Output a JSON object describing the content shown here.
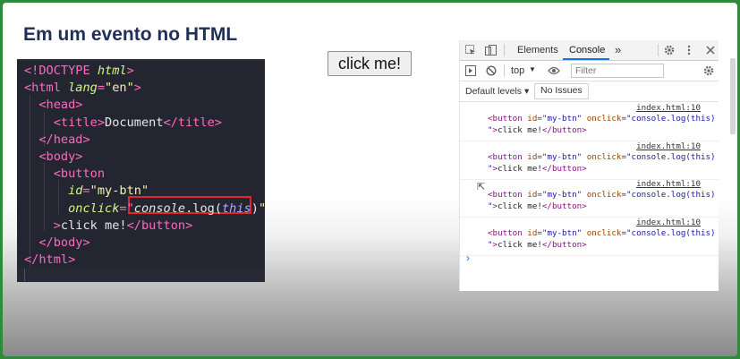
{
  "slide": {
    "title": "Em um evento no HTML"
  },
  "code": {
    "lines": [
      {
        "parts": [
          {
            "t": "<!DOCTYPE ",
            "c": "tag"
          },
          {
            "t": "html",
            "c": "attr"
          },
          {
            "t": ">",
            "c": "tag"
          }
        ]
      },
      {
        "parts": [
          {
            "t": "<html ",
            "c": "tag"
          },
          {
            "t": "lang",
            "c": "attr"
          },
          {
            "t": "=",
            "c": "tag"
          },
          {
            "t": "\"en\"",
            "c": "str"
          },
          {
            "t": ">",
            "c": "tag"
          }
        ]
      },
      {
        "parts": [
          {
            "t": "  <head>",
            "c": "tag"
          }
        ]
      },
      {
        "parts": [
          {
            "t": "    <title>",
            "c": "tag"
          },
          {
            "t": "Document",
            "c": ""
          },
          {
            "t": "</title>",
            "c": "tag"
          }
        ]
      },
      {
        "parts": [
          {
            "t": "  </head>",
            "c": "tag"
          }
        ]
      },
      {
        "parts": [
          {
            "t": "  <body>",
            "c": "tag"
          }
        ]
      },
      {
        "parts": [
          {
            "t": "    <button",
            "c": "tag"
          }
        ]
      },
      {
        "parts": [
          {
            "t": "      ",
            "c": ""
          },
          {
            "t": "id",
            "c": "attr"
          },
          {
            "t": "=",
            "c": "tag"
          },
          {
            "t": "\"my-btn\"",
            "c": "str"
          }
        ]
      },
      {
        "parts": [
          {
            "t": "      ",
            "c": ""
          },
          {
            "t": "onclick",
            "c": "attr"
          },
          {
            "t": "=\"",
            "c": "tag"
          },
          {
            "t": "console",
            "c": "ital"
          },
          {
            "t": ".log(",
            "c": ""
          },
          {
            "t": "this",
            "c": "kw"
          },
          {
            "t": ")",
            "c": ""
          },
          {
            "t": "\"",
            "c": "str"
          }
        ]
      },
      {
        "parts": [
          {
            "t": "    >",
            "c": "tag"
          },
          {
            "t": "click me!",
            "c": ""
          },
          {
            "t": "</button>",
            "c": "tag"
          }
        ]
      },
      {
        "parts": [
          {
            "t": "  </body>",
            "c": "tag"
          }
        ]
      },
      {
        "parts": [
          {
            "t": "</html>",
            "c": "tag"
          }
        ]
      }
    ]
  },
  "page": {
    "button_label": "click me!"
  },
  "devtools": {
    "tabs": [
      "Elements",
      "Console"
    ],
    "more_tabs_icon": "»",
    "context": "top",
    "filter_placeholder": "Filter",
    "levels_label": "Default levels",
    "issues_label": "No Issues",
    "entries": [
      {
        "source": "index.html:10",
        "line1": {
          "tag_open": "<button",
          "a1": "id",
          "v1": "\"my-btn\"",
          "a2": "onclick",
          "v2": "\"console.log(this)"
        },
        "line2": {
          "v_end": "\"",
          "tag_close": ">",
          "text": "click me!",
          "end_tag": "</button>"
        }
      },
      {
        "source": "index.html:10",
        "line1": {
          "tag_open": "<button",
          "a1": "id",
          "v1": "\"my-btn\"",
          "a2": "onclick",
          "v2": "\"console.log(this)"
        },
        "line2": {
          "v_end": "\"",
          "tag_close": ">",
          "text": "click me!",
          "end_tag": "</button>"
        }
      },
      {
        "source": "index.html:10",
        "line1": {
          "tag_open": "<button",
          "a1": "id",
          "v1": "\"my-btn\"",
          "a2": "onclick",
          "v2": "\"console.log(this)"
        },
        "line2": {
          "v_end": "\"",
          "tag_close": ">",
          "text": "click me!",
          "end_tag": "</button>"
        }
      },
      {
        "source": "index.html:10",
        "line1": {
          "tag_open": "<button",
          "a1": "id",
          "v1": "\"my-btn\"",
          "a2": "onclick",
          "v2": "\"console.log(this)"
        },
        "line2": {
          "v_end": "\"",
          "tag_close": ">",
          "text": "click me!",
          "end_tag": "</button>"
        }
      }
    ],
    "prompt_icon": "›"
  },
  "icons": {
    "inspect": "inspect-element-icon",
    "device": "device-toolbar-icon",
    "settings": "gear-icon",
    "menu": "kebab-menu-icon",
    "close": "close-icon",
    "sidebar": "sidebar-toggle-icon",
    "clear": "clear-console-icon",
    "eye": "live-expression-icon"
  }
}
